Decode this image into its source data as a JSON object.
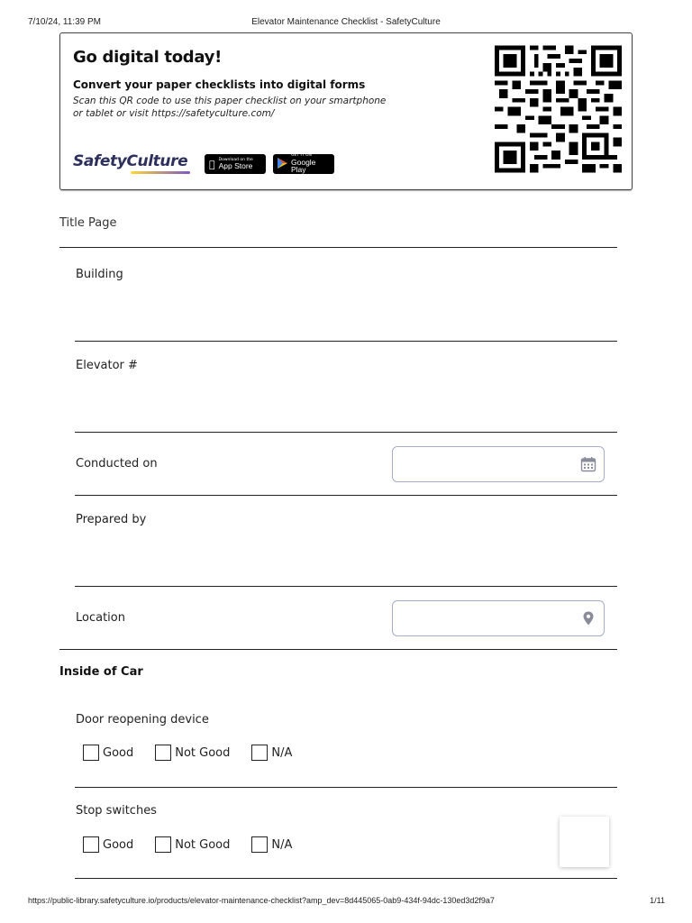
{
  "print_header": {
    "date": "7/10/24, 11:39 PM",
    "title": "Elevator Maintenance Checklist - SafetyCulture"
  },
  "banner": {
    "headline": "Go digital today!",
    "subhead": "Convert your paper checklists into digital forms",
    "scan_text": "Scan this QR code to use this paper checklist on your smartphone or tablet or visit https://safetyculture.com/",
    "brand": "SafetyCulture",
    "appstore_small": "Download on the",
    "appstore_big": "App Store",
    "googleplay_small": "GET IT ON",
    "googleplay_big": "Google Play",
    "qr_icon": "qr-code"
  },
  "title_page": {
    "heading": "Title Page",
    "fields": {
      "building": "Building",
      "elevator": "Elevator #",
      "conducted_on": "Conducted on",
      "prepared_by": "Prepared by",
      "location": "Location"
    },
    "conducted_on_icon": "calendar-icon",
    "location_icon": "map-pin-icon"
  },
  "inside_of_car": {
    "heading": "Inside of Car",
    "items": [
      {
        "label": "Door reopening device",
        "options": [
          "Good",
          "Not Good",
          "N/A"
        ]
      },
      {
        "label": "Stop switches",
        "options": [
          "Good",
          "Not Good",
          "N/A"
        ]
      }
    ]
  },
  "print_footer": {
    "url": "https://public-library.safetyculture.io/products/elevator-maintenance-checklist?amp_dev=8d445065-0ab9-434f-94dc-130ed3d2f9a7",
    "page": "1/11"
  },
  "colors": {
    "brand_navy": "#2d2f5c",
    "input_border": "#a7acc6",
    "rule": "#222222"
  }
}
